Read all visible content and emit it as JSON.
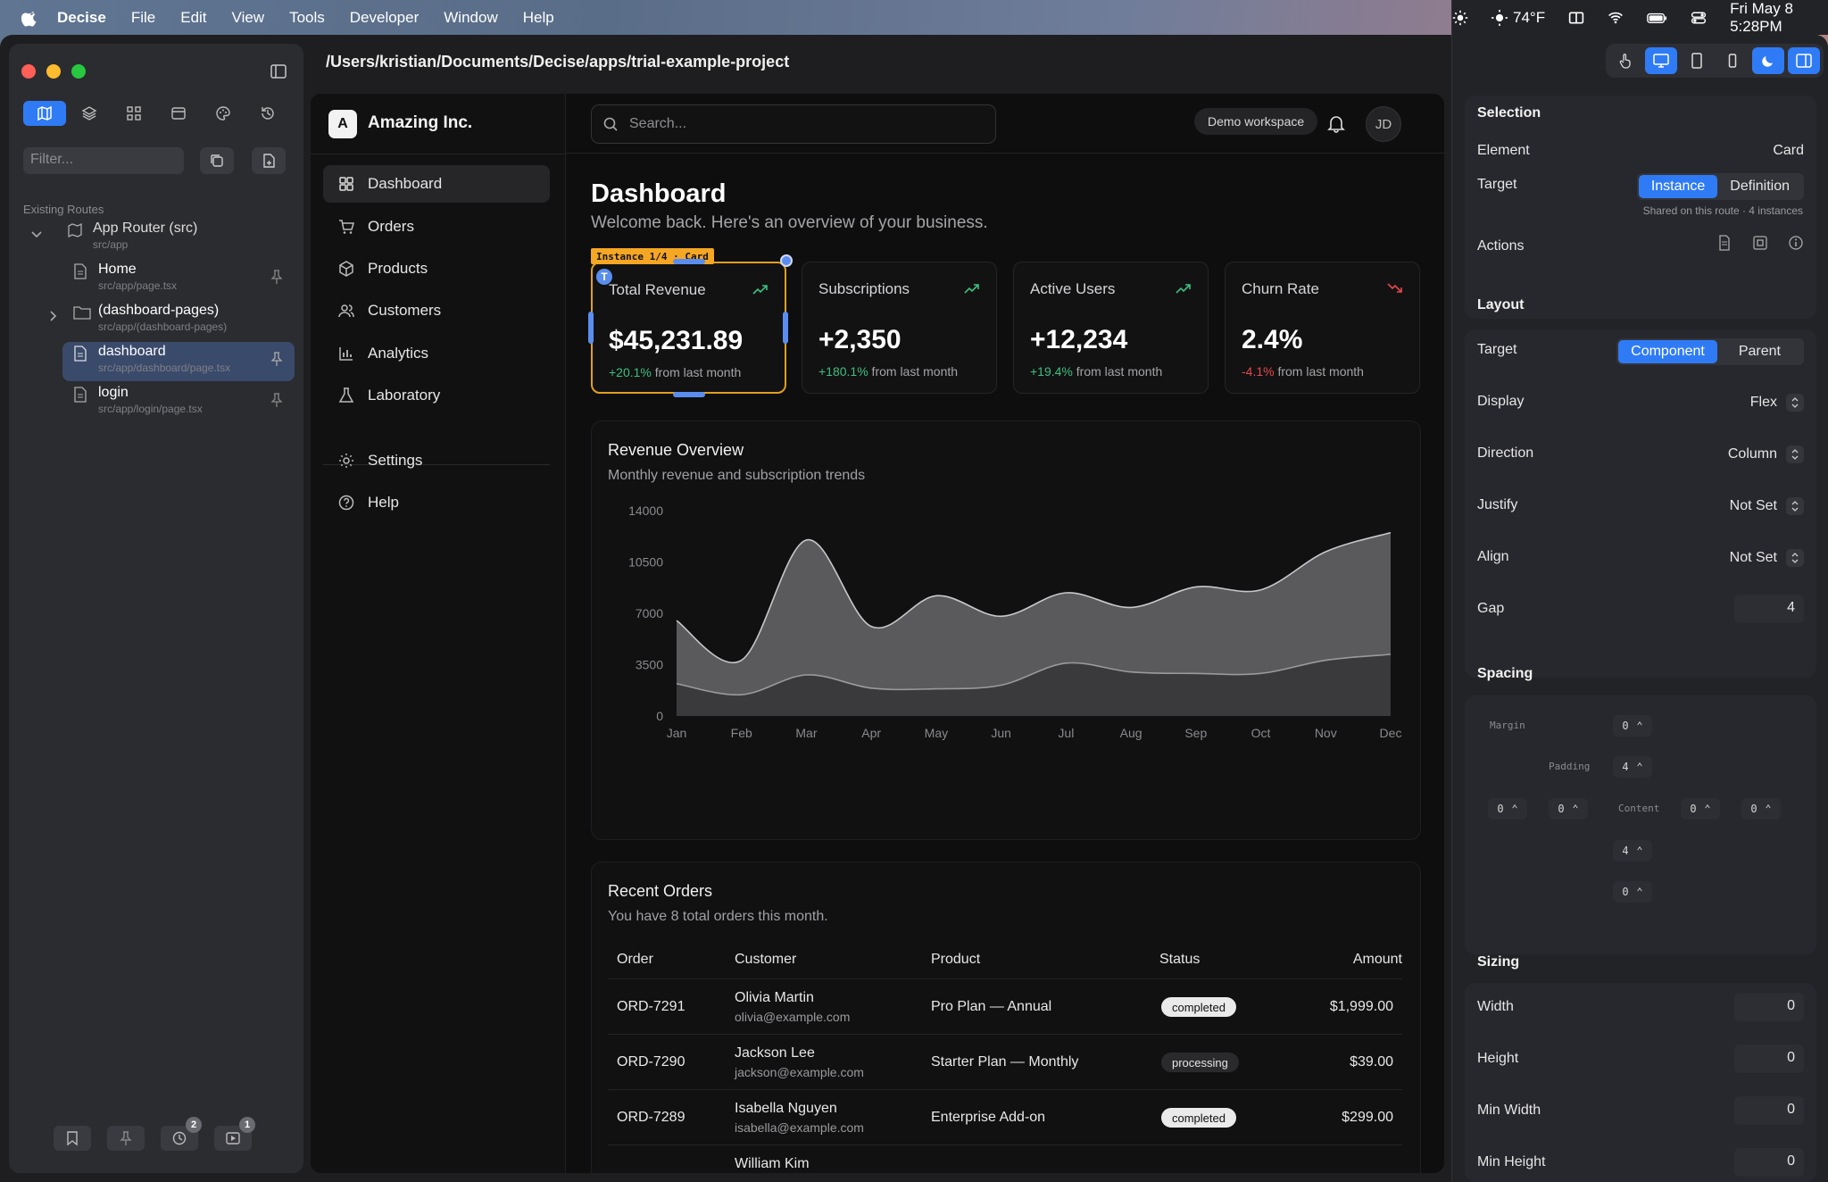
{
  "menubar": {
    "app": "Decise",
    "items": [
      "File",
      "Edit",
      "View",
      "Tools",
      "Developer",
      "Window",
      "Help"
    ],
    "temp": "74°F",
    "datetime": "Fri May 8  5:28PM"
  },
  "left_panel": {
    "filter_placeholder": "Filter...",
    "section_title": "Existing Routes",
    "routes": [
      {
        "name": "App Router (src)",
        "path": "src/app"
      },
      {
        "name": "Home",
        "path": "src/app/page.tsx"
      },
      {
        "name": "(dashboard-pages)",
        "path": "src/app/(dashboard-pages)"
      },
      {
        "name": "dashboard",
        "path": "src/app/dashboard/page.tsx"
      },
      {
        "name": "login",
        "path": "src/app/login/page.tsx"
      }
    ],
    "badges": {
      "history": "2",
      "preview": "1"
    }
  },
  "project_path": "/Users/kristian/Documents/Decise/apps/trial-example-project",
  "app": {
    "company": "Amazing Inc.",
    "logo_letter": "A",
    "nav": [
      "Dashboard",
      "Orders",
      "Products",
      "Customers",
      "Analytics",
      "Laboratory",
      "Settings",
      "Help"
    ],
    "search_placeholder": "Search...",
    "workspace": "Demo workspace",
    "avatar": "JD",
    "title": "Dashboard",
    "subtitle": "Welcome back. Here's an overview of your business.",
    "instance_label": "Instance 1/4 · Card",
    "cards": [
      {
        "title": "Total Revenue",
        "value": "$45,231.89",
        "change": "+20.1%",
        "suffix": " from last month",
        "trend": "up"
      },
      {
        "title": "Subscriptions",
        "value": "+2,350",
        "change": "+180.1%",
        "suffix": " from last month",
        "trend": "up"
      },
      {
        "title": "Active Users",
        "value": "+12,234",
        "change": "+19.4%",
        "suffix": " from last month",
        "trend": "up"
      },
      {
        "title": "Churn Rate",
        "value": "2.4%",
        "change": "-4.1%",
        "suffix": " from last month",
        "trend": "down"
      }
    ],
    "revenue": {
      "title": "Revenue Overview",
      "subtitle": "Monthly revenue and subscription trends"
    },
    "orders": {
      "title": "Recent Orders",
      "subtitle": "You have 8 total orders this month.",
      "headers": [
        "Order",
        "Customer",
        "Product",
        "Status",
        "Amount"
      ],
      "rows": [
        {
          "id": "ORD-7291",
          "name": "Olivia Martin",
          "email": "olivia@example.com",
          "product": "Pro Plan — Annual",
          "status": "completed",
          "amount": "$1,999.00"
        },
        {
          "id": "ORD-7290",
          "name": "Jackson Lee",
          "email": "jackson@example.com",
          "product": "Starter Plan — Monthly",
          "status": "processing",
          "amount": "$39.00"
        },
        {
          "id": "ORD-7289",
          "name": "Isabella Nguyen",
          "email": "isabella@example.com",
          "product": "Enterprise Add-on",
          "status": "completed",
          "amount": "$299.00"
        },
        {
          "id": "",
          "name": "William Kim",
          "email": "",
          "product": "",
          "status": "",
          "amount": ""
        }
      ]
    }
  },
  "chart_data": {
    "type": "area",
    "categories": [
      "Jan",
      "Feb",
      "Mar",
      "Apr",
      "May",
      "Jun",
      "Jul",
      "Aug",
      "Sep",
      "Oct",
      "Nov",
      "Dec"
    ],
    "y_ticks": [
      "14000",
      "10500",
      "7000",
      "3500",
      "0"
    ],
    "ylim": [
      0,
      14000
    ],
    "series": [
      {
        "values": [
          6500,
          3800,
          12000,
          6100,
          8200,
          6800,
          8400,
          7400,
          8800,
          8600,
          11200,
          12500
        ],
        "color": "#5a5a5d"
      },
      {
        "values": [
          2200,
          1450,
          2800,
          1900,
          1850,
          2100,
          3600,
          3000,
          2900,
          2900,
          3800,
          4200
        ],
        "color": "#3a3a3c"
      }
    ]
  },
  "inspector": {
    "selection": {
      "title": "Selection",
      "element_label": "Element",
      "element_value": "Card",
      "target_label": "Target",
      "target_options": [
        "Instance",
        "Definition"
      ],
      "note": "Shared on this route · 4 instances",
      "actions_label": "Actions"
    },
    "layout": {
      "title": "Layout",
      "target_label": "Target",
      "target_options": [
        "Component",
        "Parent"
      ],
      "rows": [
        {
          "label": "Display",
          "value": "Flex"
        },
        {
          "label": "Direction",
          "value": "Column"
        },
        {
          "label": "Justify",
          "value": "Not Set"
        },
        {
          "label": "Align",
          "value": "Not Set"
        }
      ],
      "gap_label": "Gap",
      "gap_value": "4"
    },
    "spacing": {
      "title": "Spacing",
      "margin_label": "Margin",
      "padding_label": "Padding",
      "content_label": "Content",
      "margin_top": "0",
      "padding_top": "4",
      "left_outer": "0",
      "left_inner": "0",
      "right_inner": "0",
      "right_outer": "0",
      "padding_bottom": "4",
      "margin_bottom": "0"
    },
    "sizing": {
      "title": "Sizing",
      "rows": [
        {
          "label": "Width",
          "value": "0"
        },
        {
          "label": "Height",
          "value": "0"
        },
        {
          "label": "Min Width",
          "value": "0"
        },
        {
          "label": "Min Height",
          "value": "0"
        }
      ]
    }
  }
}
